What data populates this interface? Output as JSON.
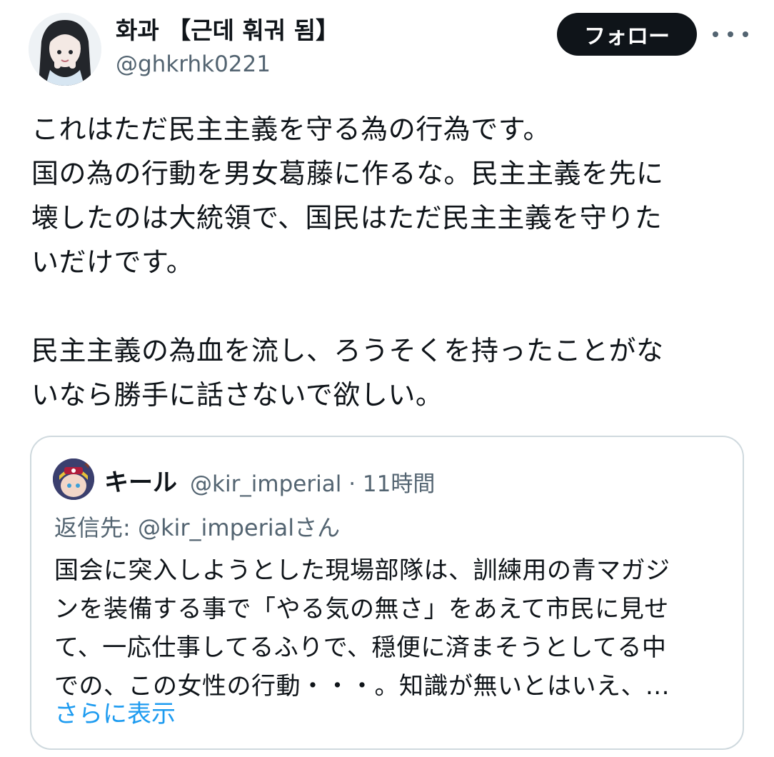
{
  "author": {
    "display_name": "화과 【근데 훠궈 됨】",
    "handle": "@ghkrhk0221",
    "avatar_icon": "profile-avatar-anime-girl"
  },
  "actions": {
    "follow_label": "フォロー",
    "more_icon": "more-horizontal-icon"
  },
  "tweet": {
    "text": "これはただ民主主義を守る為の行為です。\n国の為の行動を男女葛藤に作るな。民主主義を先に\n壊したのは大統領で、国民はただ民主主義を守りた\nいだけです。\n\n民主主義の為血を流し、ろうそくを持ったことがな\nいなら勝手に話さないで欲しい。"
  },
  "quoted_tweet": {
    "display_name": "キール",
    "handle_time": "@kir_imperial · 11時間",
    "reply_to": "返信先: @kir_imperialさん",
    "text": "国会に突入しようとした現場部隊は、訓練用の青マガジ\nンを装備する事で「やる気の無さ」をあえて市民に見せ\nて、一応仕事してるふりで、穏便に済まそうとしてる中\nでの、この女性の行動・・・。知識が無いとはいえ、...",
    "show_more": "さらに表示",
    "avatar_icon": "profile-avatar-character"
  },
  "colors": {
    "text_primary": "#0f1419",
    "text_secondary": "#536471",
    "link": "#1d9bf0",
    "border": "#cfd9de",
    "button_bg": "#0f1419"
  }
}
